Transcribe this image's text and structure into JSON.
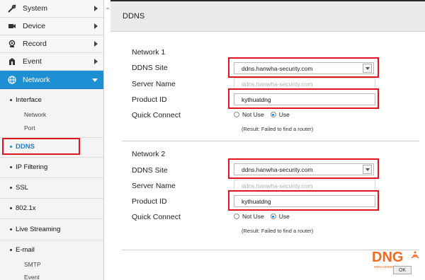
{
  "sidebar": {
    "top_items": [
      {
        "label": "System",
        "icon": "tools-icon"
      },
      {
        "label": "Device",
        "icon": "camera-icon"
      },
      {
        "label": "Record",
        "icon": "record-icon"
      },
      {
        "label": "Event",
        "icon": "event-icon"
      },
      {
        "label": "Network",
        "icon": "globe-icon"
      }
    ],
    "network_items": {
      "interface": "Interface",
      "network": "Network",
      "port": "Port",
      "ddns": "DDNS",
      "ip_filtering": "IP Filtering",
      "ssl": "SSL",
      "dot1x": "802.1x",
      "live_streaming": "Live Streaming",
      "email": "E-mail",
      "smtp": "SMTP",
      "event": "Event"
    }
  },
  "page": {
    "title": "DDNS"
  },
  "network1": {
    "heading": "Network 1",
    "ddns_site_label": "DDNS Site",
    "ddns_site_value": "ddns.hanwha-security.com",
    "server_name_label": "Server Name",
    "server_name_value": "ddns.hanwha-security.com",
    "product_id_label": "Product ID",
    "product_id_value": "kythuatdng",
    "quick_connect_label": "Quick Connect",
    "opt_not_use": "Not Use",
    "opt_use": "Use",
    "result": "(Result: Failed to find a router)"
  },
  "network2": {
    "heading": "Network 2",
    "ddns_site_label": "DDNS Site",
    "ddns_site_value": "ddns.hanwha-security.com",
    "server_name_label": "Server Name",
    "server_name_value": "ddns.hanwha-security.com",
    "product_id_label": "Product ID",
    "product_id_value": "kythuatdng",
    "quick_connect_label": "Quick Connect",
    "opt_not_use": "Not Use",
    "opt_use": "Use",
    "result": "(Result: Failed to find a router)"
  },
  "footer": {
    "logo_text": "DNG",
    "logo_site": "www.camerahanoi.vn",
    "ok_label": "OK"
  },
  "colors": {
    "accent": "#1f8fd4",
    "highlight_box": "#e0141e",
    "logo": "#f26a21"
  }
}
